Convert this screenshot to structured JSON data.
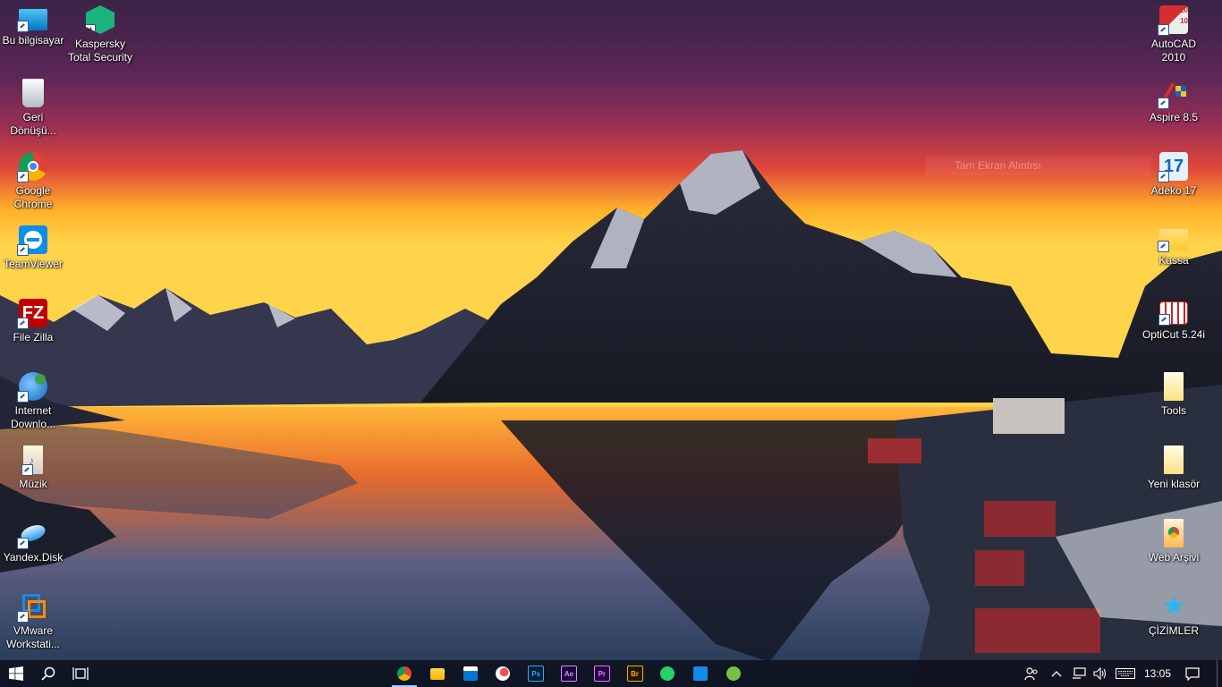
{
  "desktop": {
    "left_col1": [
      {
        "label": "Bu bilgisayar",
        "icon": "computer-icon"
      },
      {
        "label": "Geri\nDönüşü...",
        "icon": "recycle-bin-icon"
      },
      {
        "label": "Google\nChrome",
        "icon": "chrome-icon"
      },
      {
        "label": "TeamViewer",
        "icon": "teamviewer-icon"
      },
      {
        "label": "File Zilla",
        "icon": "filezilla-icon"
      },
      {
        "label": "Internet\nDownlo...",
        "icon": "internet-download-manager-icon"
      },
      {
        "label": "Müzik",
        "icon": "music-folder-icon"
      },
      {
        "label": "Yandex.Disk",
        "icon": "yandex-disk-icon"
      },
      {
        "label": "VMware\nWorkstati...",
        "icon": "vmware-icon"
      }
    ],
    "left_col2": [
      {
        "label": "Kaspersky\nTotal Security",
        "icon": "kaspersky-icon"
      }
    ],
    "right_col": [
      {
        "label": "AutoCAD\n2010",
        "icon": "autocad-icon"
      },
      {
        "label": "Aspire 8.5",
        "icon": "aspire-icon"
      },
      {
        "label": "Adeko 17",
        "icon": "adeko-icon"
      },
      {
        "label": "Kassa",
        "icon": "folder-icon"
      },
      {
        "label": "OptiCut 5.24i",
        "icon": "opticut-icon"
      },
      {
        "label": "Tools",
        "icon": "folder-icon"
      },
      {
        "label": "Yeni klasör",
        "icon": "folder-icon"
      },
      {
        "label": "Web Arşivi",
        "icon": "folder-icon"
      },
      {
        "label": "ÇİZİMLER",
        "icon": "star-icon"
      }
    ]
  },
  "ghost_text": "Tam Ekran Alıntısı",
  "taskbar": {
    "pinned": [
      {
        "name": "chrome-icon",
        "text": ""
      },
      {
        "name": "file-explorer-icon",
        "text": ""
      },
      {
        "name": "store-icon",
        "text": ""
      },
      {
        "name": "paint-icon",
        "text": ""
      },
      {
        "name": "photoshop-icon",
        "text": "Ps"
      },
      {
        "name": "after-effects-icon",
        "text": "Ae"
      },
      {
        "name": "premiere-icon",
        "text": "Pr"
      },
      {
        "name": "bridge-icon",
        "text": "Br"
      },
      {
        "name": "whatsapp-icon",
        "text": ""
      },
      {
        "name": "teamviewer-icon",
        "text": ""
      },
      {
        "name": "utorrent-icon",
        "text": ""
      }
    ],
    "clock": "13:05"
  },
  "colors": {
    "taskbar_bg": "#0c0e1a",
    "accent_blue": "#2b5797"
  }
}
